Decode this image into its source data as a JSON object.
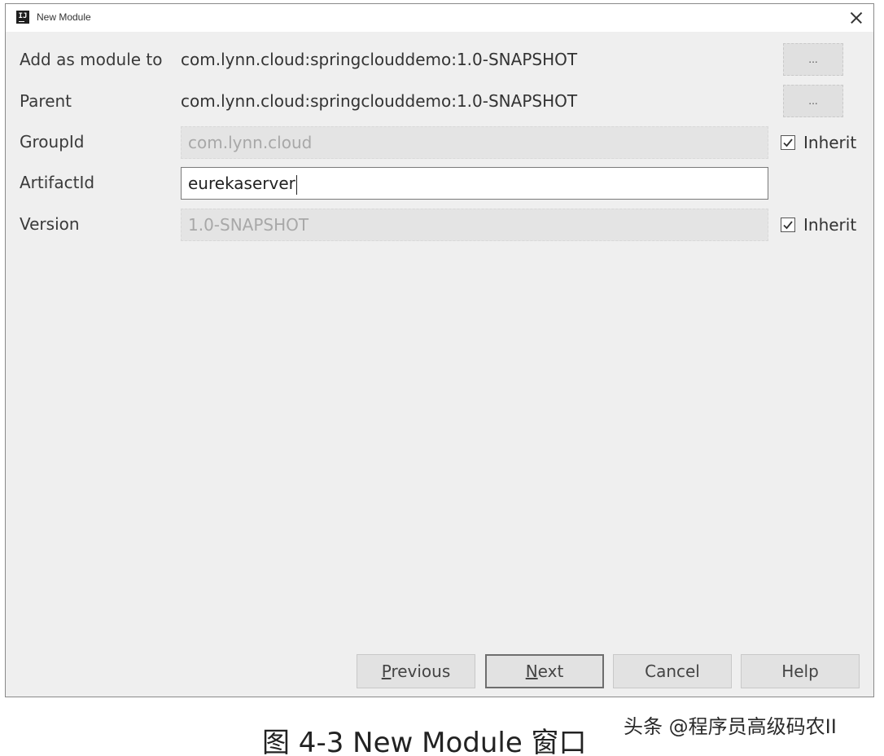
{
  "window": {
    "title": "New Module"
  },
  "form": {
    "add_as_module": {
      "label": "Add as module to",
      "value": "com.lynn.cloud:springclouddemo:1.0-SNAPSHOT",
      "browse_label": "..."
    },
    "parent": {
      "label": "Parent",
      "value": "com.lynn.cloud:springclouddemo:1.0-SNAPSHOT",
      "browse_label": "..."
    },
    "group_id": {
      "label": "GroupId",
      "value": "com.lynn.cloud",
      "inherit_label": "Inherit",
      "inherit_checked": true
    },
    "artifact_id": {
      "label": "ArtifactId",
      "value": "eurekaserver"
    },
    "version": {
      "label": "Version",
      "value": "1.0-SNAPSHOT",
      "inherit_label": "Inherit",
      "inherit_checked": true
    }
  },
  "buttons": {
    "previous": {
      "mnemonic": "P",
      "rest": "revious"
    },
    "next": {
      "mnemonic": "N",
      "rest": "ext"
    },
    "cancel": "Cancel",
    "help": "Help"
  },
  "caption": "图 4-3 New Module 窗口",
  "watermark": "头条 @程序员高级码农II",
  "icons": {
    "app": "intellij-idea-icon",
    "close": "close-icon",
    "check": "checkmark-icon"
  }
}
